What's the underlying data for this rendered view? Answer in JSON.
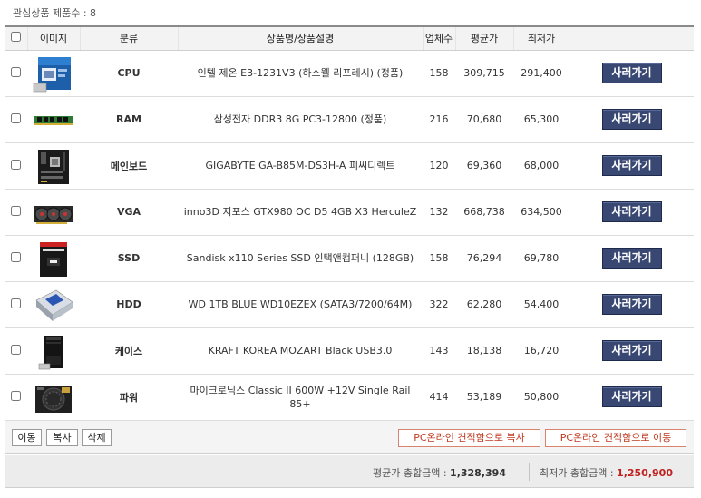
{
  "header": {
    "label": "관심상품 제품수 :",
    "count": "8"
  },
  "columns": {
    "image": "이미지",
    "category": "분류",
    "name": "상품명/상품설명",
    "sellers": "업체수",
    "avg": "평균가",
    "min": "최저가"
  },
  "rows": [
    {
      "category": "CPU",
      "name": "인텔 제온 E3-1231V3 (하스웰 리프레시) (정품)",
      "sellers": "158",
      "avg": "309,715",
      "min": "291,400",
      "button": "사러가기",
      "icon": "cpu-box-icon"
    },
    {
      "category": "RAM",
      "name": "삼성전자 DDR3 8G PC3-12800 (정품)",
      "sellers": "216",
      "avg": "70,680",
      "min": "65,300",
      "button": "사러가기",
      "icon": "ram-stick-icon"
    },
    {
      "category": "메인보드",
      "name": "GIGABYTE GA-B85M-DS3H-A 피씨디렉트",
      "sellers": "120",
      "avg": "69,360",
      "min": "68,000",
      "button": "사러가기",
      "icon": "motherboard-icon"
    },
    {
      "category": "VGA",
      "name": "inno3D 지포스 GTX980 OC D5 4GB X3 HerculeZ",
      "sellers": "132",
      "avg": "668,738",
      "min": "634,500",
      "button": "사러가기",
      "icon": "graphics-card-icon"
    },
    {
      "category": "SSD",
      "name": "Sandisk x110 Series SSD 인택앤컴퍼니 (128GB)",
      "sellers": "158",
      "avg": "76,294",
      "min": "69,780",
      "button": "사러가기",
      "icon": "ssd-icon"
    },
    {
      "category": "HDD",
      "name": "WD 1TB BLUE WD10EZEX (SATA3/7200/64M)",
      "sellers": "322",
      "avg": "62,280",
      "min": "54,400",
      "button": "사러가기",
      "icon": "hard-drive-icon"
    },
    {
      "category": "케이스",
      "name": "KRAFT KOREA MOZART Black USB3.0",
      "sellers": "143",
      "avg": "18,138",
      "min": "16,720",
      "button": "사러가기",
      "icon": "pc-case-icon"
    },
    {
      "category": "파워",
      "name": "마이크로닉스 Classic II 600W +12V Single Rail 85+",
      "sellers": "414",
      "avg": "53,189",
      "min": "50,800",
      "button": "사러가기",
      "icon": "power-supply-icon"
    }
  ],
  "actions": {
    "move": "이동",
    "copy": "복사",
    "delete": "삭제",
    "copy_to_estimate": "PC온라인 견적함으로 복사",
    "move_to_estimate": "PC온라인 견적함으로 이동"
  },
  "totals": {
    "avg_label": "평균가 총합금액 :",
    "avg_value": "1,328,394",
    "min_label": "최저가 총합금액 :",
    "min_value": "1,250,900"
  },
  "colors": {
    "button_bg": "#384872",
    "price_red": "#b5271f",
    "outline_red": "#d9826e"
  }
}
